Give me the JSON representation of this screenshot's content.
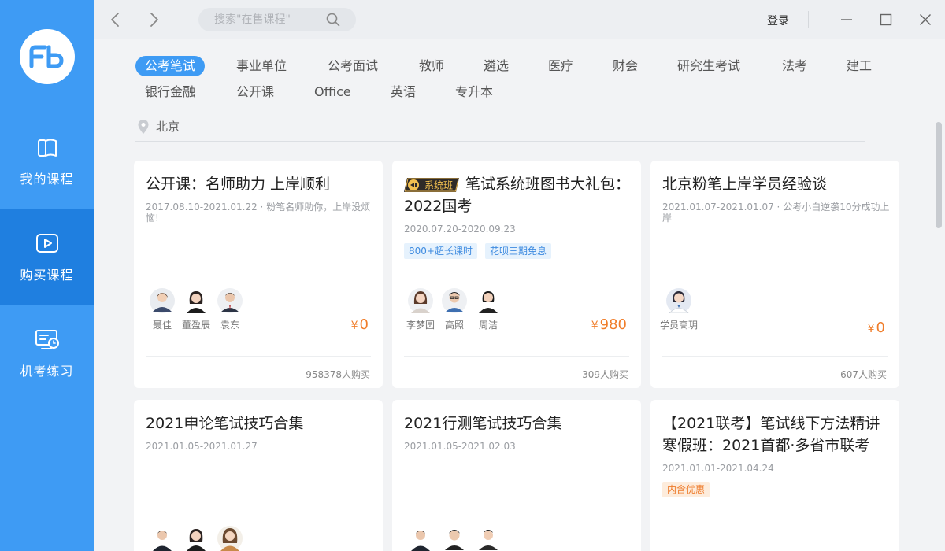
{
  "sidebar": {
    "logo_text": "Fb",
    "items": [
      {
        "label": "我的课程",
        "icon": "book-icon"
      },
      {
        "label": "购买课程",
        "icon": "play-icon"
      },
      {
        "label": "机考练习",
        "icon": "monitor-clock-icon"
      }
    ],
    "active_index": 1
  },
  "topbar": {
    "search_placeholder": "搜索\"在售课程\"",
    "login_label": "登录"
  },
  "categories": {
    "row1": [
      "公考笔试",
      "事业单位",
      "公考面试",
      "教师",
      "遴选",
      "医疗",
      "财会",
      "研究生考试",
      "法考",
      "建工"
    ],
    "row2": [
      "银行金融",
      "公开课",
      "Office",
      "英语",
      "专升本"
    ],
    "active": "公考笔试"
  },
  "location": "北京",
  "colors": {
    "accent": "#3e9bf4",
    "active_nav": "#1f7fe0",
    "price": "#f07d2a"
  },
  "courses": [
    {
      "title": "公开课：名师助力 上岸顺利",
      "subtitle": "2017.08.10-2021.01.22 · 粉笔名师助你，上岸没烦恼!",
      "teachers": [
        "聂佳",
        "董盈辰",
        "袁东"
      ],
      "price": "0",
      "buyers": "958378人购买"
    },
    {
      "badge": "系统班",
      "title": "笔试系统班图书大礼包：2022国考",
      "subtitle": "2020.07.20-2020.09.23",
      "tags": [
        "800+超长课时",
        "花呗三期免息"
      ],
      "teachers": [
        "李梦圆",
        "高照",
        "周洁"
      ],
      "price": "980",
      "buyers": "309人购买"
    },
    {
      "title": "北京粉笔上岸学员经验谈",
      "subtitle": "2021.01.07-2021.01.07 · 公考小白逆袭10分成功上岸",
      "teachers": [
        "学员高玥"
      ],
      "price": "0",
      "buyers": "607人购买"
    },
    {
      "title": "2021申论笔试技巧合集",
      "subtitle": "2021.01.05-2021.01.27"
    },
    {
      "title": "2021行测笔试技巧合集",
      "subtitle": "2021.01.05-2021.02.03"
    },
    {
      "title": "【2021联考】笔试线下方法精讲寒假班：2021首都·多省市联考",
      "subtitle": "2021.01.01-2021.04.24",
      "tags": [
        "内含优惠"
      ]
    }
  ],
  "currency_symbol": "¥"
}
